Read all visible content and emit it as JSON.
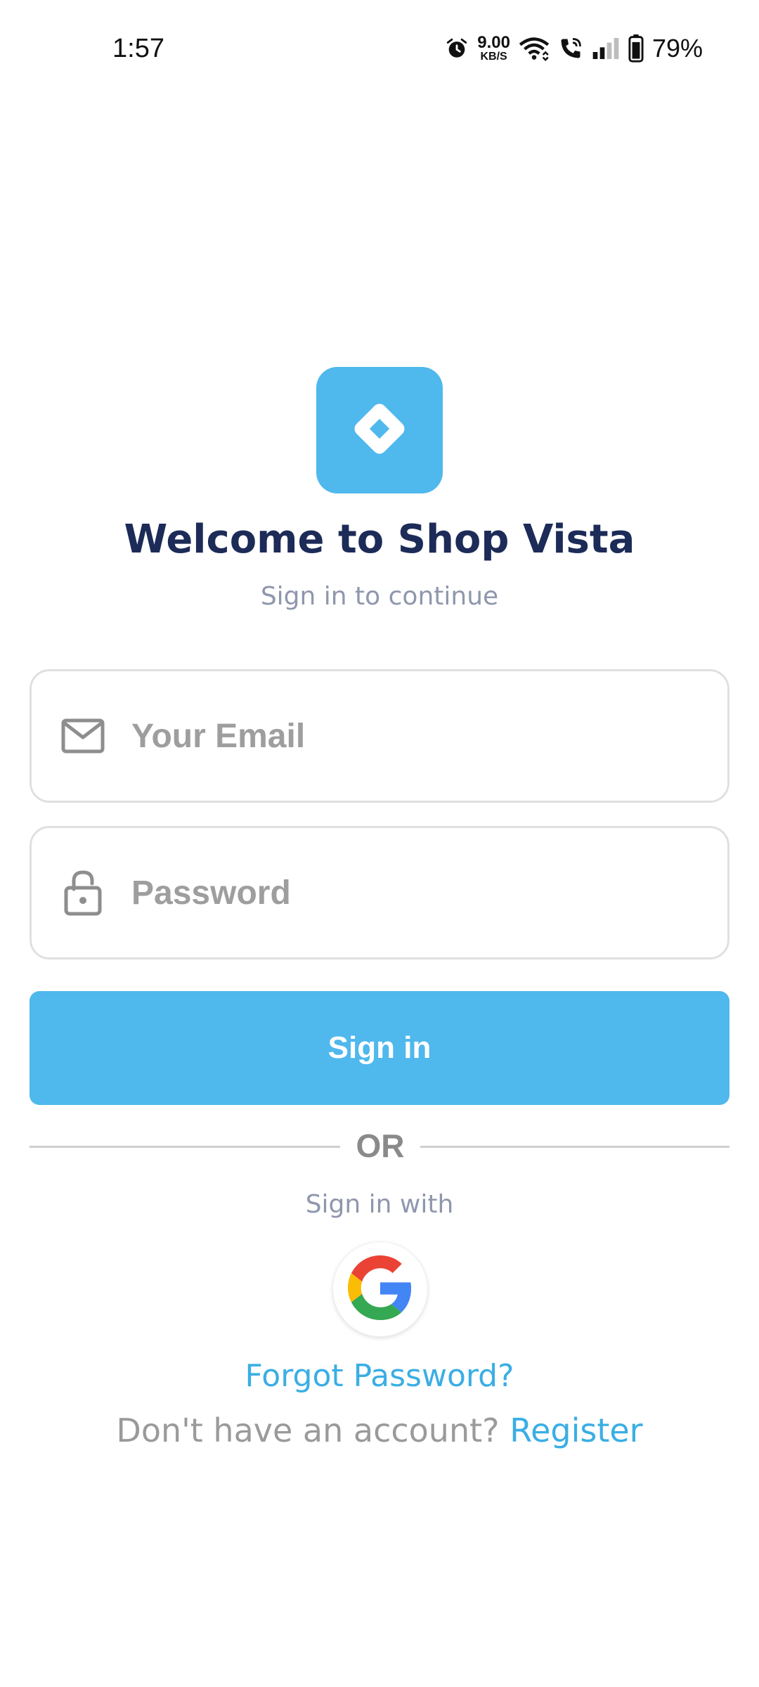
{
  "status_bar": {
    "time": "1:57",
    "net_speed_value": "9.00",
    "net_speed_unit": "KB/S",
    "battery_percent": "79%",
    "icons": [
      "alarm-icon",
      "wifi-icon",
      "wifi-call-icon",
      "signal-icon",
      "battery-icon"
    ]
  },
  "header": {
    "logo_icon": "diamond-logo-icon",
    "title": "Welcome to Shop Vista",
    "subtitle": "Sign in to continue"
  },
  "form": {
    "email": {
      "placeholder": "Your Email",
      "value": "",
      "icon": "mail-icon"
    },
    "password": {
      "placeholder": "Password",
      "value": "",
      "icon": "lock-icon"
    },
    "signin_label": "Sign in"
  },
  "social": {
    "divider_text": "OR",
    "signin_with_text": "Sign in with",
    "google_icon": "google-icon"
  },
  "links": {
    "forgot_password": "Forgot Password?",
    "no_account_text": "Don't have an account?",
    "register": "Register"
  },
  "colors": {
    "accent": "#4fb8ec",
    "link": "#3aaee4",
    "title": "#1c2b57",
    "muted": "#8f97ad"
  }
}
